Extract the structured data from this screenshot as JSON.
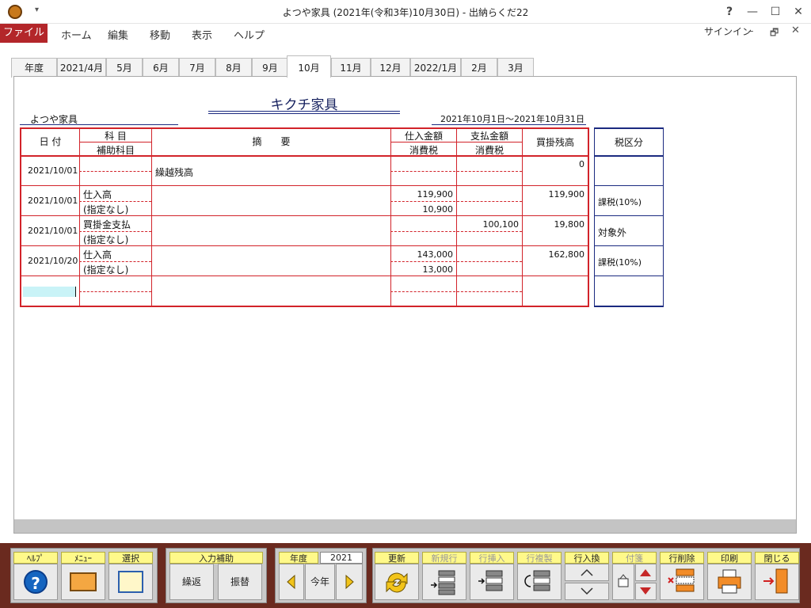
{
  "window": {
    "title": "よつや家具 (2021年(令和3年)10月30日) - 出納らくだ22",
    "help": "?",
    "minimize": "—",
    "maximize": "☐",
    "close": "✕"
  },
  "qat": "▾",
  "menu": {
    "file": "ファイル",
    "items": [
      "ホーム",
      "編集",
      "移動",
      "表示",
      "ヘルプ"
    ],
    "signin": "サインイン",
    "ribbon_min": "–",
    "ribbon_restore": "🗗",
    "ribbon_close": "✕"
  },
  "tabs": [
    "年度",
    "2021/4月",
    "5月",
    "6月",
    "7月",
    "8月",
    "9月",
    "10月",
    "11月",
    "12月",
    "2022/1月",
    "2月",
    "3月"
  ],
  "active_tab": "10月",
  "ledger": {
    "title": "キクチ家具",
    "company": "よつや家具",
    "period": "2021年10月1日～2021年10月31日",
    "headers": {
      "date": "日 付",
      "account": "科 目",
      "subaccount": "補助科目",
      "memo": "摘　　要",
      "purchase": "仕入金額",
      "purchase_tax": "消費税",
      "payment": "支払金額",
      "payment_tax": "消費税",
      "balance": "買掛残高",
      "tax_class": "税区分"
    },
    "rows": [
      {
        "date": "2021/10/01",
        "account": "",
        "sub": "",
        "memo": "繰越残高",
        "purchase": "",
        "purchase_tax": "",
        "payment": "",
        "payment_tax": "",
        "balance": "0",
        "tax": ""
      },
      {
        "date": "2021/10/01",
        "account": "仕入高",
        "sub": "(指定なし)",
        "memo": "",
        "purchase": "119,900",
        "purchase_tax": "10,900",
        "payment": "",
        "payment_tax": "",
        "balance": "119,900",
        "tax": "課税(10%)"
      },
      {
        "date": "2021/10/01",
        "account": "買掛金支払",
        "sub": "(指定なし)",
        "memo": "",
        "purchase": "",
        "purchase_tax": "",
        "payment": "100,100",
        "payment_tax": "",
        "balance": "19,800",
        "tax": "対象外"
      },
      {
        "date": "2021/10/20",
        "account": "仕入高",
        "sub": "(指定なし)",
        "memo": "",
        "purchase": "143,000",
        "purchase_tax": "13,000",
        "payment": "",
        "payment_tax": "",
        "balance": "162,800",
        "tax": "課税(10%)"
      },
      {
        "date": "",
        "account": "",
        "sub": "",
        "memo": "",
        "purchase": "",
        "purchase_tax": "",
        "payment": "",
        "payment_tax": "",
        "balance": "",
        "tax": ""
      }
    ]
  },
  "toolbar": {
    "help": "ﾍﾙﾌﾟ",
    "menu": "ﾒﾆｭｰ",
    "select": "選択",
    "input_assist": "入力補助",
    "carry": "繰返",
    "transfer": "振替",
    "year": "年度",
    "year_value": "2021",
    "this_year": "今年",
    "update": "更新",
    "new_row": "新規行",
    "insert_row": "行挿入",
    "copy_row": "行複製",
    "swap_row": "行入換",
    "note": "付箋",
    "delete_row": "行削除",
    "print": "印刷",
    "close": "閉じる"
  }
}
